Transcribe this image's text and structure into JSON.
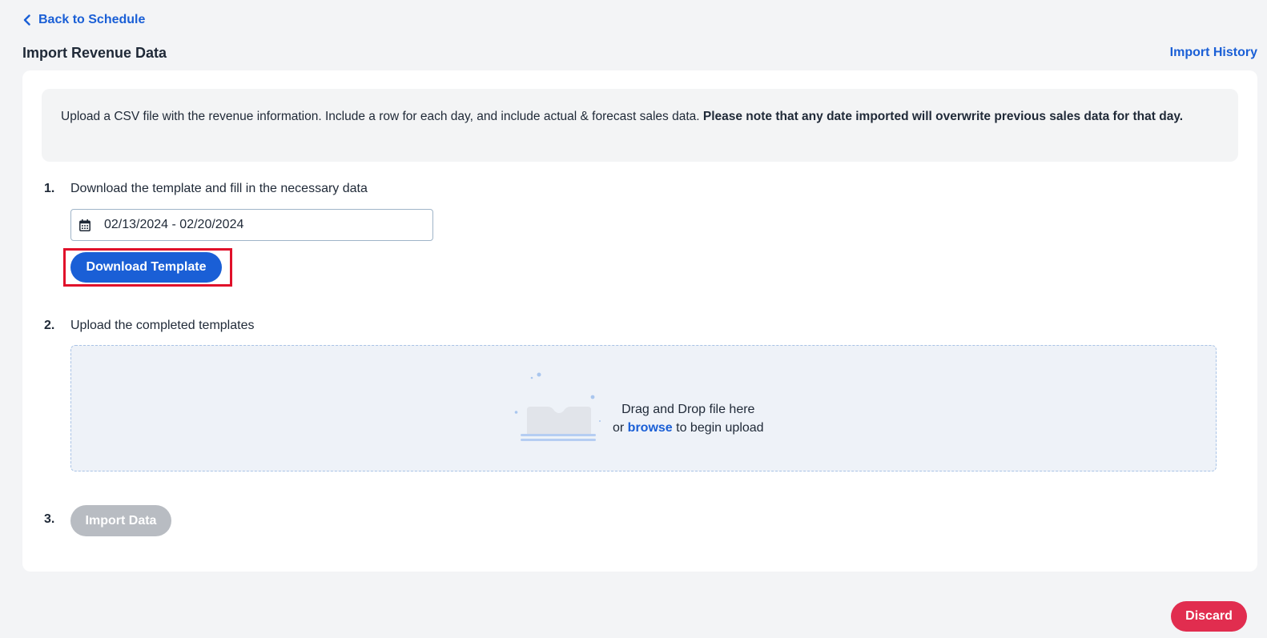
{
  "nav": {
    "back_label": "Back to Schedule",
    "history_label": "Import History"
  },
  "page": {
    "title": "Import Revenue Data"
  },
  "notice": {
    "text": "Upload a CSV file with the revenue information. Include a row for each day, and include actual & forecast sales data. ",
    "bold_text": "Please note that any date imported will overwrite previous sales data for that day."
  },
  "steps": [
    {
      "number": "1.",
      "text": "Download the template and fill in the necessary data"
    },
    {
      "number": "2.",
      "text": "Upload the completed templates"
    },
    {
      "number": "3."
    }
  ],
  "date_range": {
    "value": "02/13/2024 - 02/20/2024",
    "icon": "calendar-icon"
  },
  "buttons": {
    "download_template": "Download Template",
    "import_data": "Import Data",
    "discard": "Discard"
  },
  "dropzone": {
    "line1": "Drag and Drop file here",
    "line2_prefix": "or ",
    "browse": "browse",
    "line2_suffix": " to begin upload",
    "icon": "upload-tray-icon"
  },
  "colors": {
    "accent": "#1a5fd6",
    "danger": "#e12d4f",
    "disabled": "#b8bcc2",
    "highlight": "#e0102a"
  }
}
